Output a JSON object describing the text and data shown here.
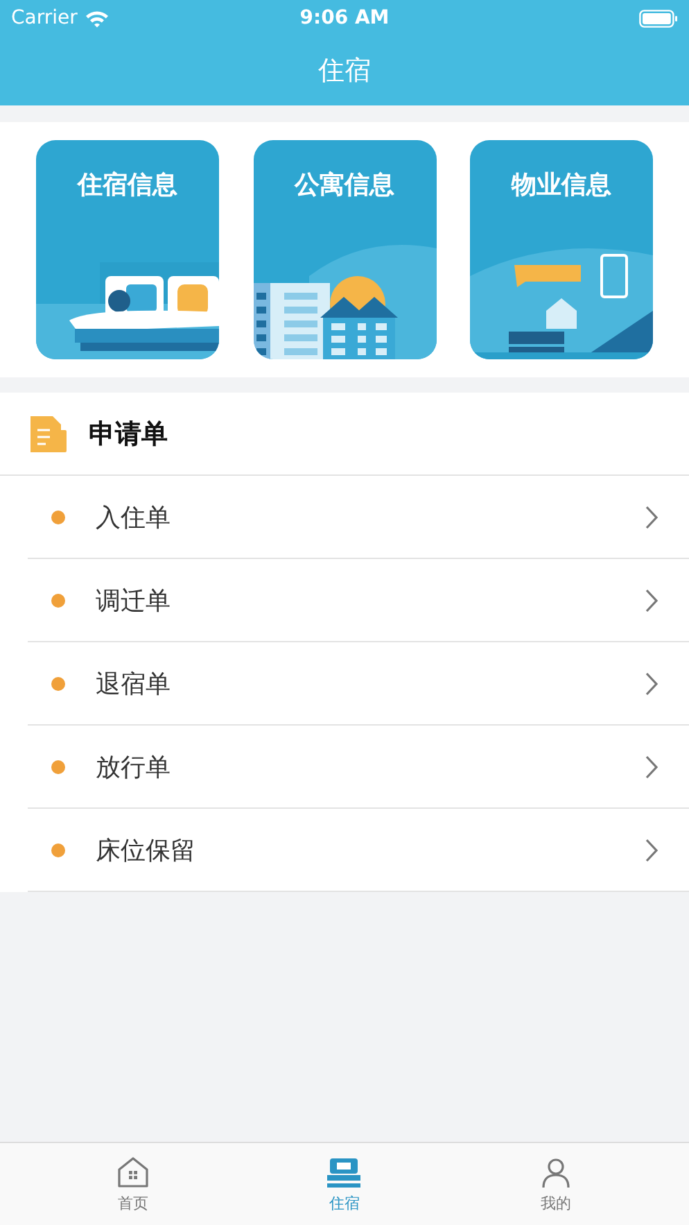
{
  "status_bar": {
    "carrier": "Carrier",
    "time": "9:06 AM"
  },
  "nav_bar": {
    "title": "住宿"
  },
  "cards": [
    {
      "title": "住宿信息",
      "kind": "bed"
    },
    {
      "title": "公寓信息",
      "kind": "buildings"
    },
    {
      "title": "物业信息",
      "kind": "devices"
    }
  ],
  "section": {
    "title": "申请单",
    "items": [
      {
        "label": "入住单"
      },
      {
        "label": "调迁单"
      },
      {
        "label": "退宿单"
      },
      {
        "label": "放行单"
      },
      {
        "label": "床位保留"
      }
    ]
  },
  "tab_bar": [
    {
      "label": "首页",
      "kind": "home",
      "selected": false
    },
    {
      "label": "住宿",
      "kind": "bed",
      "selected": true
    },
    {
      "label": "我的",
      "kind": "person",
      "selected": false
    }
  ]
}
